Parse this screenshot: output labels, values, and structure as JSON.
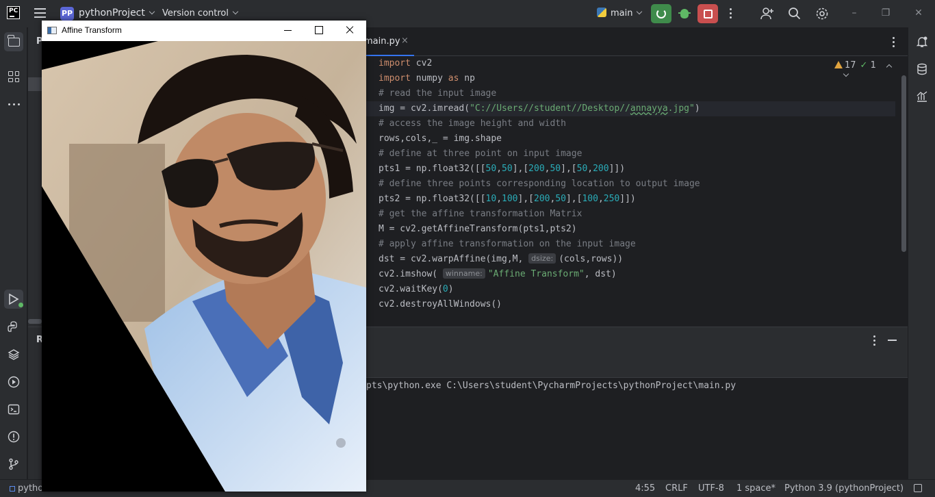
{
  "titlebar": {
    "app_logo": "PC",
    "project_badge": "PP",
    "project_name": "pythonProject",
    "version_control": "Version control",
    "run_config": "main"
  },
  "project_panel": {
    "header": "P"
  },
  "editor": {
    "tab_label": "main.py",
    "tab_close": "×",
    "warnings": "17",
    "ok_count": "1"
  },
  "code_lines": [
    "import cv2",
    "import numpy as np",
    "# read the input image",
    "img = cv2.imread(\"C://Users//student//Desktop//annayya.jpg\")",
    "# access the image height and width",
    "rows,cols,_ = img.shape",
    "# define at three point on input image",
    "pts1 = np.float32([[50,50],[200,50],[50,200]])",
    "# define three points corresponding location to output image",
    "pts2 = np.float32([[10,100],[200,50],[100,250]])",
    "# get the affine transformation Matrix",
    "M = cv2.getAffineTransform(pts1,pts2)",
    "# apply affine transformation on the input image",
    "dst = cv2.warpAffine(img,M, dsize: (cols,rows))",
    "cv2.imshow( winname: \"Affine Transform\", dst)",
    "cv2.waitKey(0)",
    "cv2.destroyAllWindows()"
  ],
  "hints": {
    "dsize": "dsize:",
    "winname": "winname:"
  },
  "run_panel": {
    "header": "R",
    "console_text": "pts\\python.exe C:\\Users\\student\\PycharmProjects\\pythonProject\\main.py"
  },
  "statusbar": {
    "left": "pytho",
    "position": "4:55",
    "line_sep": "CRLF",
    "encoding": "UTF-8",
    "indent": "1 space*",
    "interpreter": "Python 3.9 (pythonProject)"
  },
  "cv_window": {
    "title": "Affine Transform"
  },
  "colors": {
    "accent": "#3574f0",
    "rerun_green": "#3f8b4b",
    "stop_red": "#c94f4f",
    "keyword": "#cf8e6d",
    "string": "#6aab73",
    "number": "#2aacb8",
    "comment": "#7a7e85"
  },
  "icons": [
    "hamburger-icon",
    "python-icon",
    "rerun-icon",
    "debug-icon",
    "stop-icon",
    "more-icon",
    "add-user-icon",
    "search-icon",
    "settings-icon",
    "minimize-icon",
    "maximize-icon",
    "close-icon",
    "folder-icon",
    "structure-icon",
    "run-icon",
    "python-console-icon",
    "layers-icon",
    "services-icon",
    "terminal-icon",
    "problems-icon",
    "git-icon",
    "notifications-icon",
    "database-icon",
    "sciview-icon"
  ]
}
